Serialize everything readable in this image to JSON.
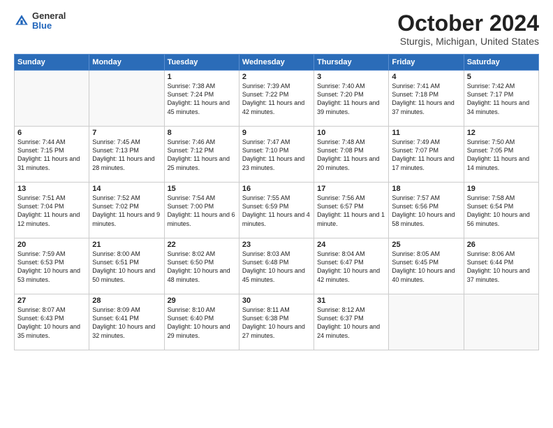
{
  "logo": {
    "general": "General",
    "blue": "Blue"
  },
  "title": "October 2024",
  "subtitle": "Sturgis, Michigan, United States",
  "days_of_week": [
    "Sunday",
    "Monday",
    "Tuesday",
    "Wednesday",
    "Thursday",
    "Friday",
    "Saturday"
  ],
  "weeks": [
    [
      {
        "day": "",
        "info": ""
      },
      {
        "day": "",
        "info": ""
      },
      {
        "day": "1",
        "info": "Sunrise: 7:38 AM\nSunset: 7:24 PM\nDaylight: 11 hours and 45 minutes."
      },
      {
        "day": "2",
        "info": "Sunrise: 7:39 AM\nSunset: 7:22 PM\nDaylight: 11 hours and 42 minutes."
      },
      {
        "day": "3",
        "info": "Sunrise: 7:40 AM\nSunset: 7:20 PM\nDaylight: 11 hours and 39 minutes."
      },
      {
        "day": "4",
        "info": "Sunrise: 7:41 AM\nSunset: 7:18 PM\nDaylight: 11 hours and 37 minutes."
      },
      {
        "day": "5",
        "info": "Sunrise: 7:42 AM\nSunset: 7:17 PM\nDaylight: 11 hours and 34 minutes."
      }
    ],
    [
      {
        "day": "6",
        "info": "Sunrise: 7:44 AM\nSunset: 7:15 PM\nDaylight: 11 hours and 31 minutes."
      },
      {
        "day": "7",
        "info": "Sunrise: 7:45 AM\nSunset: 7:13 PM\nDaylight: 11 hours and 28 minutes."
      },
      {
        "day": "8",
        "info": "Sunrise: 7:46 AM\nSunset: 7:12 PM\nDaylight: 11 hours and 25 minutes."
      },
      {
        "day": "9",
        "info": "Sunrise: 7:47 AM\nSunset: 7:10 PM\nDaylight: 11 hours and 23 minutes."
      },
      {
        "day": "10",
        "info": "Sunrise: 7:48 AM\nSunset: 7:08 PM\nDaylight: 11 hours and 20 minutes."
      },
      {
        "day": "11",
        "info": "Sunrise: 7:49 AM\nSunset: 7:07 PM\nDaylight: 11 hours and 17 minutes."
      },
      {
        "day": "12",
        "info": "Sunrise: 7:50 AM\nSunset: 7:05 PM\nDaylight: 11 hours and 14 minutes."
      }
    ],
    [
      {
        "day": "13",
        "info": "Sunrise: 7:51 AM\nSunset: 7:04 PM\nDaylight: 11 hours and 12 minutes."
      },
      {
        "day": "14",
        "info": "Sunrise: 7:52 AM\nSunset: 7:02 PM\nDaylight: 11 hours and 9 minutes."
      },
      {
        "day": "15",
        "info": "Sunrise: 7:54 AM\nSunset: 7:00 PM\nDaylight: 11 hours and 6 minutes."
      },
      {
        "day": "16",
        "info": "Sunrise: 7:55 AM\nSunset: 6:59 PM\nDaylight: 11 hours and 4 minutes."
      },
      {
        "day": "17",
        "info": "Sunrise: 7:56 AM\nSunset: 6:57 PM\nDaylight: 11 hours and 1 minute."
      },
      {
        "day": "18",
        "info": "Sunrise: 7:57 AM\nSunset: 6:56 PM\nDaylight: 10 hours and 58 minutes."
      },
      {
        "day": "19",
        "info": "Sunrise: 7:58 AM\nSunset: 6:54 PM\nDaylight: 10 hours and 56 minutes."
      }
    ],
    [
      {
        "day": "20",
        "info": "Sunrise: 7:59 AM\nSunset: 6:53 PM\nDaylight: 10 hours and 53 minutes."
      },
      {
        "day": "21",
        "info": "Sunrise: 8:00 AM\nSunset: 6:51 PM\nDaylight: 10 hours and 50 minutes."
      },
      {
        "day": "22",
        "info": "Sunrise: 8:02 AM\nSunset: 6:50 PM\nDaylight: 10 hours and 48 minutes."
      },
      {
        "day": "23",
        "info": "Sunrise: 8:03 AM\nSunset: 6:48 PM\nDaylight: 10 hours and 45 minutes."
      },
      {
        "day": "24",
        "info": "Sunrise: 8:04 AM\nSunset: 6:47 PM\nDaylight: 10 hours and 42 minutes."
      },
      {
        "day": "25",
        "info": "Sunrise: 8:05 AM\nSunset: 6:45 PM\nDaylight: 10 hours and 40 minutes."
      },
      {
        "day": "26",
        "info": "Sunrise: 8:06 AM\nSunset: 6:44 PM\nDaylight: 10 hours and 37 minutes."
      }
    ],
    [
      {
        "day": "27",
        "info": "Sunrise: 8:07 AM\nSunset: 6:43 PM\nDaylight: 10 hours and 35 minutes."
      },
      {
        "day": "28",
        "info": "Sunrise: 8:09 AM\nSunset: 6:41 PM\nDaylight: 10 hours and 32 minutes."
      },
      {
        "day": "29",
        "info": "Sunrise: 8:10 AM\nSunset: 6:40 PM\nDaylight: 10 hours and 29 minutes."
      },
      {
        "day": "30",
        "info": "Sunrise: 8:11 AM\nSunset: 6:38 PM\nDaylight: 10 hours and 27 minutes."
      },
      {
        "day": "31",
        "info": "Sunrise: 8:12 AM\nSunset: 6:37 PM\nDaylight: 10 hours and 24 minutes."
      },
      {
        "day": "",
        "info": ""
      },
      {
        "day": "",
        "info": ""
      }
    ]
  ]
}
